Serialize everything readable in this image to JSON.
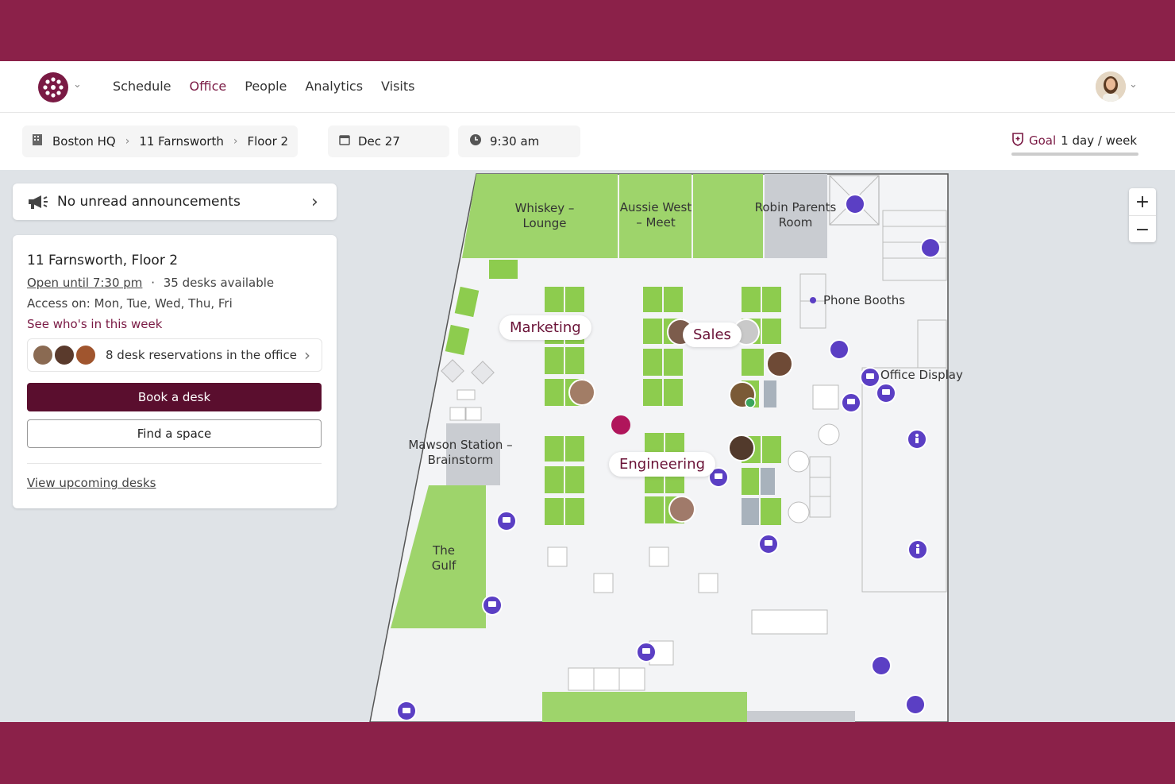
{
  "nav": {
    "links": [
      "Schedule",
      "Office",
      "People",
      "Analytics",
      "Visits"
    ],
    "active": "Office"
  },
  "breadcrumb": [
    "Boston HQ",
    "11 Farnsworth",
    "Floor 2"
  ],
  "date": "Dec 27",
  "time": "9:30 am",
  "goal": {
    "label": "Goal",
    "value": "1 day / week"
  },
  "announcements": "No unread announcements",
  "floor": {
    "title": "11 Farnsworth, Floor 2",
    "open_until": "Open until 7:30 pm",
    "dot": "·",
    "desks": "35 desks available",
    "access": "Access on: Mon, Tue, Wed, Thu, Fri",
    "whos_in": "See who's in this week",
    "reservations": "8 desk reservations in the office",
    "book": "Book a desk",
    "find": "Find a space",
    "upcoming": "View upcoming desks"
  },
  "map": {
    "rooms": {
      "whiskey": "Whiskey – Lounge",
      "aussie": "Aussie West – Meet",
      "robin": "Robin Parents Room",
      "mawson": "Mawson Station – Brainstorm",
      "gulf": "The Gulf",
      "phone": "Phone Booths",
      "display": "Office Display"
    },
    "teams": {
      "marketing": "Marketing",
      "sales": "Sales",
      "engineering": "Engineering"
    }
  },
  "zoom": {
    "in": "+",
    "out": "−"
  },
  "colors": {
    "brand": "#7a1a44",
    "room_green": "#9ed46b",
    "desk_green": "#8dcc4e",
    "icon_purple": "#5b3fc4"
  }
}
